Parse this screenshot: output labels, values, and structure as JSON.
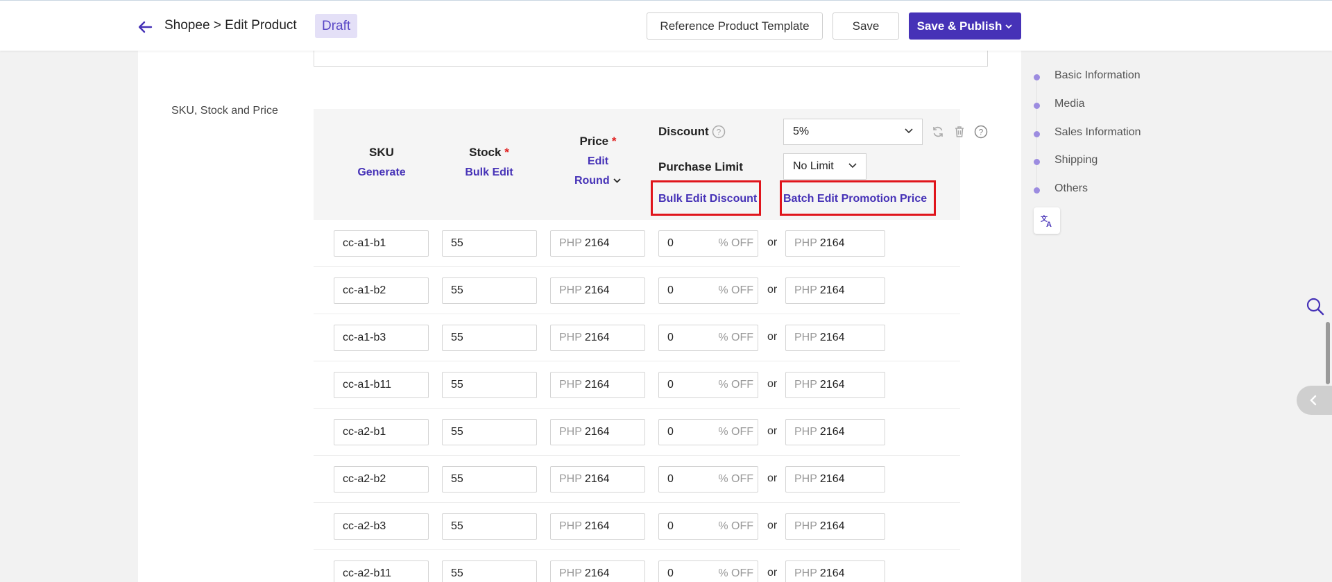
{
  "header": {
    "breadcrumb": "Shopee > Edit Product",
    "status_badge": "Draft",
    "reference_template_label": "Reference Product Template",
    "save_label": "Save",
    "publish_label": "Save & Publish"
  },
  "section": {
    "label": "SKU, Stock and Price"
  },
  "table": {
    "sku_header": "SKU",
    "sku_action": "Generate",
    "stock_header": "Stock",
    "stock_action": "Bulk Edit",
    "price_header": "Price",
    "price_edit": "Edit",
    "price_round": "Round",
    "required_mark": "*",
    "discount_label": "Discount",
    "discount_value": "5%",
    "purchase_limit_label": "Purchase Limit",
    "purchase_limit_value": "No Limit",
    "bulk_edit_discount": "Bulk Edit Discount",
    "batch_edit_promotion": "Batch Edit Promotion Price",
    "currency": "PHP",
    "off_suffix": "% OFF",
    "or_text": "or",
    "rows": [
      {
        "sku": "cc-a1-b1",
        "stock": "55",
        "price": "2164",
        "discount": "0",
        "promo": "2164"
      },
      {
        "sku": "cc-a1-b2",
        "stock": "55",
        "price": "2164",
        "discount": "0",
        "promo": "2164"
      },
      {
        "sku": "cc-a1-b3",
        "stock": "55",
        "price": "2164",
        "discount": "0",
        "promo": "2164"
      },
      {
        "sku": "cc-a1-b11",
        "stock": "55",
        "price": "2164",
        "discount": "0",
        "promo": "2164"
      },
      {
        "sku": "cc-a2-b1",
        "stock": "55",
        "price": "2164",
        "discount": "0",
        "promo": "2164"
      },
      {
        "sku": "cc-a2-b2",
        "stock": "55",
        "price": "2164",
        "discount": "0",
        "promo": "2164"
      },
      {
        "sku": "cc-a2-b3",
        "stock": "55",
        "price": "2164",
        "discount": "0",
        "promo": "2164"
      },
      {
        "sku": "cc-a2-b11",
        "stock": "55",
        "price": "2164",
        "discount": "0",
        "promo": "2164"
      }
    ]
  },
  "nav": {
    "items": [
      "Basic Information",
      "Media",
      "Sales Information",
      "Shipping",
      "Others"
    ]
  },
  "colors": {
    "accent": "#4632b7",
    "highlight": "#e0151c"
  }
}
